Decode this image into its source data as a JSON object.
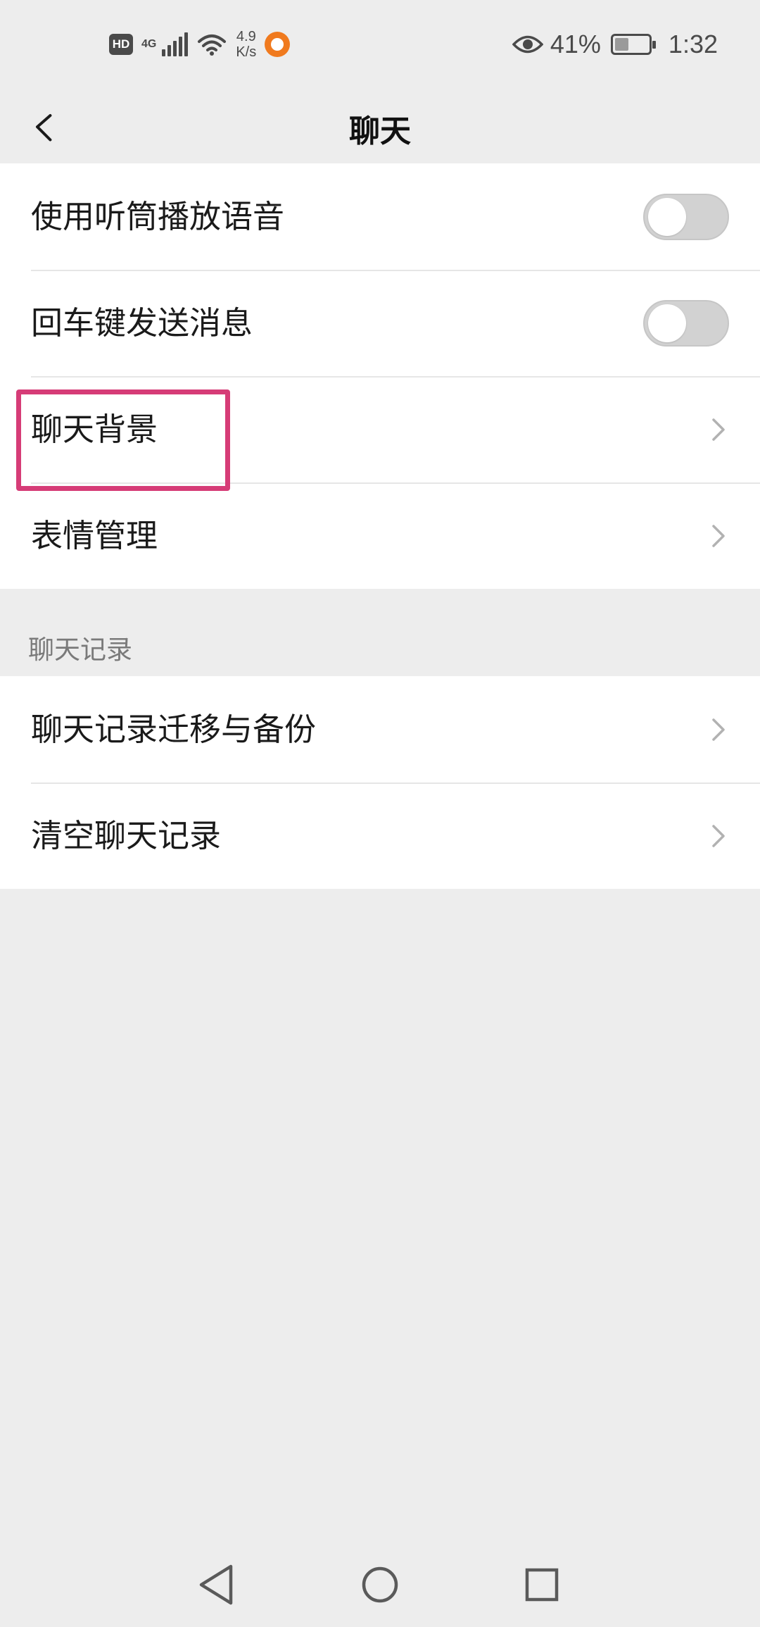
{
  "status_bar": {
    "hd": "HD",
    "network": "4G",
    "net_speed_value": "4.9",
    "net_speed_unit": "K/s",
    "battery_percent": "41%",
    "battery_level": 0.41,
    "time": "1:32"
  },
  "header": {
    "title": "聊天",
    "back_icon": "chevron-left-icon"
  },
  "group_general": {
    "items": [
      {
        "label": "使用听筒播放语音",
        "control": "toggle",
        "checked": false
      },
      {
        "label": "回车键发送消息",
        "control": "toggle",
        "checked": false
      },
      {
        "label": "聊天背景",
        "control": "chevron",
        "highlighted": true
      },
      {
        "label": "表情管理",
        "control": "chevron"
      }
    ]
  },
  "section_history": {
    "header": "聊天记录",
    "items": [
      {
        "label": "聊天记录迁移与备份",
        "control": "chevron"
      },
      {
        "label": "清空聊天记录",
        "control": "chevron"
      }
    ]
  },
  "colors": {
    "background": "#ededed",
    "card": "#ffffff",
    "highlight_border": "#d63c77",
    "toggle_off": "#d2d2d2",
    "chevron": "#b2b2b2"
  },
  "system_nav": {
    "icons": [
      "triangle-back-icon",
      "circle-home-icon",
      "square-recent-icon"
    ]
  }
}
